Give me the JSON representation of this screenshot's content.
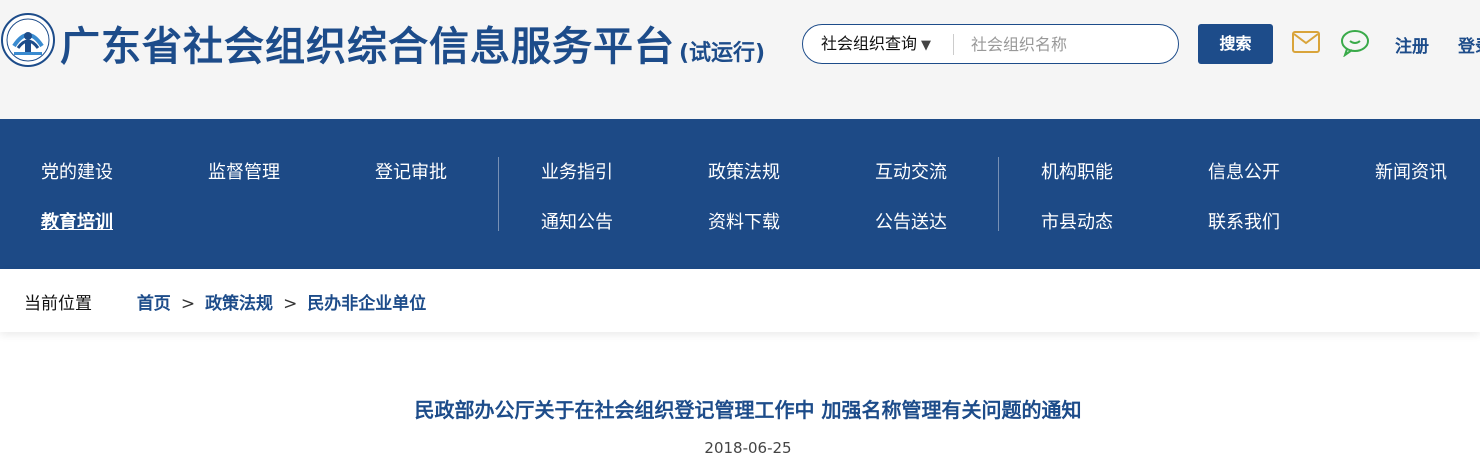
{
  "header": {
    "site_title": "广东省社会组织综合信息服务平台",
    "trial_label": "(试运行)",
    "search": {
      "type_label": "社会组织查询",
      "placeholder": "社会组织名称",
      "button_label": "搜索"
    },
    "register_label": "注册",
    "login_label": "登录"
  },
  "nav": {
    "row1": [
      "党的建设",
      "监督管理",
      "登记审批",
      "业务指引",
      "政策法规",
      "互动交流",
      "机构职能",
      "信息公开",
      "新闻资讯"
    ],
    "row2": [
      "教育培训",
      "通知公告",
      "资料下载",
      "公告送达",
      "市县动态",
      "联系我们"
    ],
    "active": "教育培训"
  },
  "breadcrumb": {
    "label": "当前位置",
    "items": [
      "首页",
      "政策法规",
      "民办非企业单位"
    ],
    "separator": ">"
  },
  "article": {
    "title": "民政部办公厅关于在社会组织登记管理工作中 加强名称管理有关问题的通知",
    "date": "2018-06-25"
  },
  "colors": {
    "brand_blue": "#1d4c8a",
    "nav_background": "#1d4a86",
    "header_background": "#f5f5f5",
    "mail_icon": "#d9a43a",
    "chat_icon": "#3aaa4a"
  },
  "icons": [
    "site-logo-icon",
    "dropdown-caret-icon",
    "mail-icon",
    "chat-icon"
  ]
}
